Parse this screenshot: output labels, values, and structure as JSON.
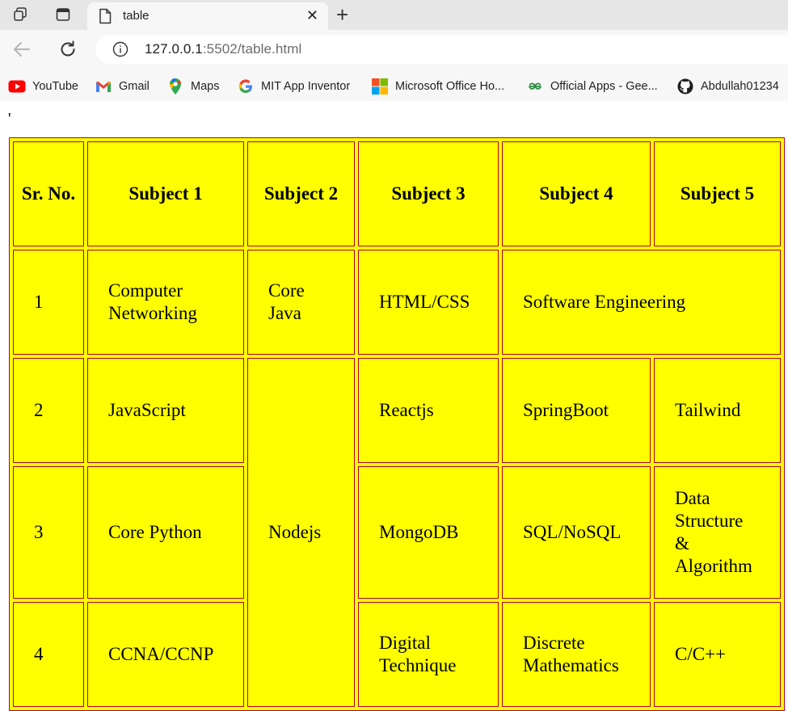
{
  "browser": {
    "tab": {
      "title": "table"
    },
    "address_bar": {
      "host": "127.0.0.1",
      "path": ":5502/table.html"
    },
    "bookmarks": [
      {
        "label": "YouTube",
        "icon": "youtube-icon"
      },
      {
        "label": "Gmail",
        "icon": "gmail-icon"
      },
      {
        "label": "Maps",
        "icon": "maps-icon"
      },
      {
        "label": "MIT App Inventor",
        "icon": "google-icon"
      },
      {
        "label": "Microsoft Office Ho...",
        "icon": "microsoft-icon"
      },
      {
        "label": "Official Apps - Gee...",
        "icon": "geeksforgeeks-icon"
      },
      {
        "label": "Abdullah01234",
        "icon": "github-icon"
      }
    ]
  },
  "page": {
    "stray_char": "'",
    "table": {
      "headers": [
        "Sr. No.",
        "Subject 1",
        "Subject 2",
        "Subject 3",
        "Subject 4",
        "Subject 5"
      ],
      "rows": [
        {
          "sr": "1",
          "s1": "Computer Networking",
          "s2": "Core Java",
          "s3": "HTML/CSS",
          "s4_5": "Software Engineering"
        },
        {
          "sr": "2",
          "s1": "JavaScript",
          "s2_merged": "Nodejs",
          "s3": "Reactjs",
          "s4": "SpringBoot",
          "s5": "Tailwind"
        },
        {
          "sr": "3",
          "s1": "Core Python",
          "s3": "MongoDB",
          "s4": "SQL/NoSQL",
          "s5": "Data Structure & Algorithm"
        },
        {
          "sr": "4",
          "s1": "CCNA/CCNP",
          "s3": "Digital Technique",
          "s4": "Discrete Mathematics",
          "s5": "C/C++"
        }
      ]
    }
  },
  "colors": {
    "table_background": "#ffff00",
    "cell_border": "#b0003a"
  }
}
